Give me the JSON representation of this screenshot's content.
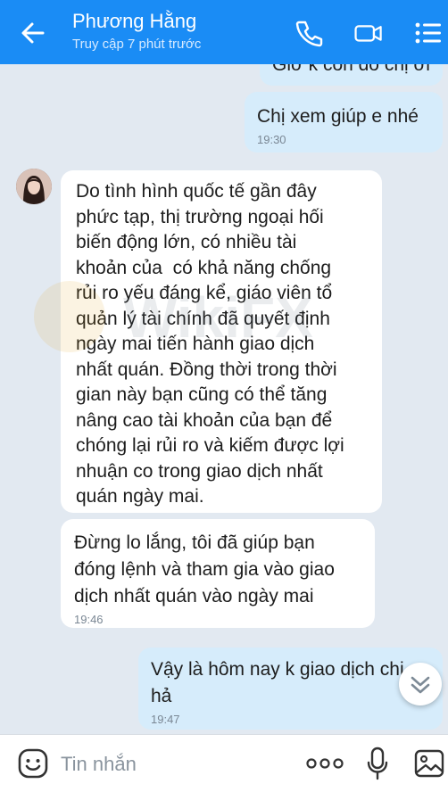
{
  "header": {
    "contact_name": "Phương Hằng",
    "status": "Truy cập 7 phút trước"
  },
  "messages": [
    {
      "side": "sent",
      "text": "Giờ k còn đó chị ơi",
      "time": ""
    },
    {
      "side": "sent",
      "text": "Chị xem giúp e nhé",
      "time": "19:30"
    },
    {
      "side": "recv",
      "text": "Do tình hình quốc tế gần đây\nphức tạp, thị trường ngoại hối\nbiến động lớn, có nhiều tài\nkhoản của  có khả năng chống\nrủi ro yếu đáng kể, giáo viên tổ\nquản lý tài chính đã quyết định\nngày mai tiến hành giao dịch\nnhất quán. Đồng thời trong thời\ngian này bạn cũng có thể tăng\nnâng cao tài khoản của bạn để\nchóng lại rủi ro và kiếm được lợi\nnhuận co trong giao dịch nhất\nquán ngày mai.",
      "time": ""
    },
    {
      "side": "recv",
      "text": "Đừng lo lắng, tôi đã giúp bạn\nđóng lệnh và tham gia vào giao\ndịch nhất quán vào ngày mai",
      "time": "19:46"
    },
    {
      "side": "sent",
      "text": "Vậy là hôm nay k giao dịch chị\nhả",
      "time": "19:47"
    }
  ],
  "composer": {
    "placeholder": "Tin nhắn"
  },
  "watermark": {
    "text": "WikiFX"
  },
  "colors": {
    "header": "#1a8cf5",
    "sent_bubble": "#d6ecfb",
    "recv_bubble": "#ffffff",
    "background": "#e2e9f1"
  },
  "icons": [
    "back-arrow-icon",
    "phone-icon",
    "video-call-icon",
    "menu-icon",
    "emoji-icon",
    "more-dots-icon",
    "microphone-icon",
    "image-icon",
    "chevron-down-icon"
  ]
}
